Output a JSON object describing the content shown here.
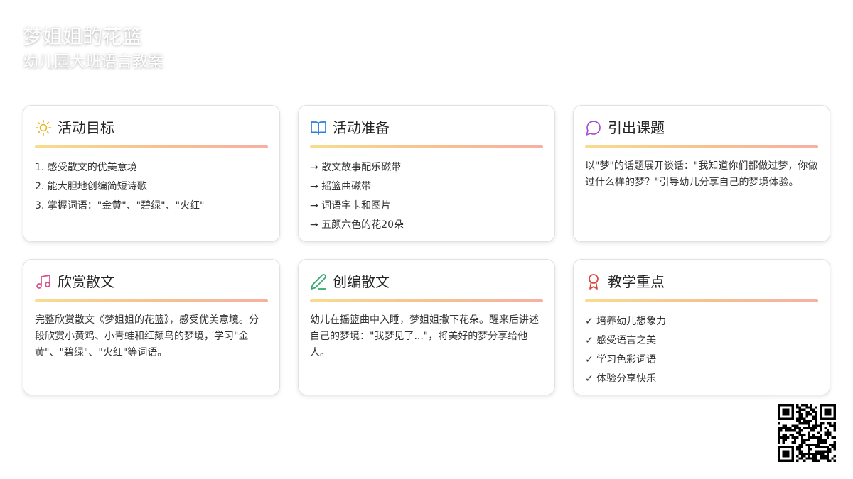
{
  "header": {
    "title": "梦姐姐的花篮",
    "subtitle": "幼儿园大班语言教案"
  },
  "cards": [
    {
      "title": "活动目标",
      "icon": "sun-icon",
      "color": "#e6b422",
      "items": [
        "1. 感受散文的优美意境",
        "2. 能大胆地创编简短诗歌",
        "3. 掌握词语：\"金黄\"、\"碧绿\"、\"火红\""
      ]
    },
    {
      "title": "活动准备",
      "icon": "open-book-icon",
      "color": "#2f7fd9",
      "items": [
        "→ 散文故事配乐磁带",
        "→ 摇篮曲磁带",
        "→ 词语字卡和图片",
        "→ 五颜六色的花20朵"
      ]
    },
    {
      "title": "引出课题",
      "icon": "chat-bubble-icon",
      "color": "#a34fd4",
      "text": "以\"梦\"的话题展开谈话：\"我知道你们都做过梦，你做过什么样的梦？\"引导幼儿分享自己的梦境体验。"
    },
    {
      "title": "欣赏散文",
      "icon": "music-note-icon",
      "color": "#d94f8a",
      "text": "完整欣赏散文《梦姐姐的花篮》，感受优美意境。分段欣赏小黄鸡、小青蛙和红颏鸟的梦境，学习\"金黄\"、\"碧绿\"、\"火红\"等词语。"
    },
    {
      "title": "创编散文",
      "icon": "pencil-icon",
      "color": "#2fa96b",
      "text": "幼儿在摇篮曲中入睡，梦姐姐撒下花朵。醒来后讲述自己的梦境：\"我梦见了...\"，将美好的梦分享给他人。"
    },
    {
      "title": "教学重点",
      "icon": "award-ribbon-icon",
      "color": "#d9463b",
      "items": [
        "✓ 培养幼儿想象力",
        "✓ 感受语言之美",
        "✓ 学习色彩词语",
        "✓ 体验分享快乐"
      ]
    }
  ],
  "colors": {
    "divider_start": "#f8dc8f",
    "divider_end": "#f6b0a3"
  }
}
